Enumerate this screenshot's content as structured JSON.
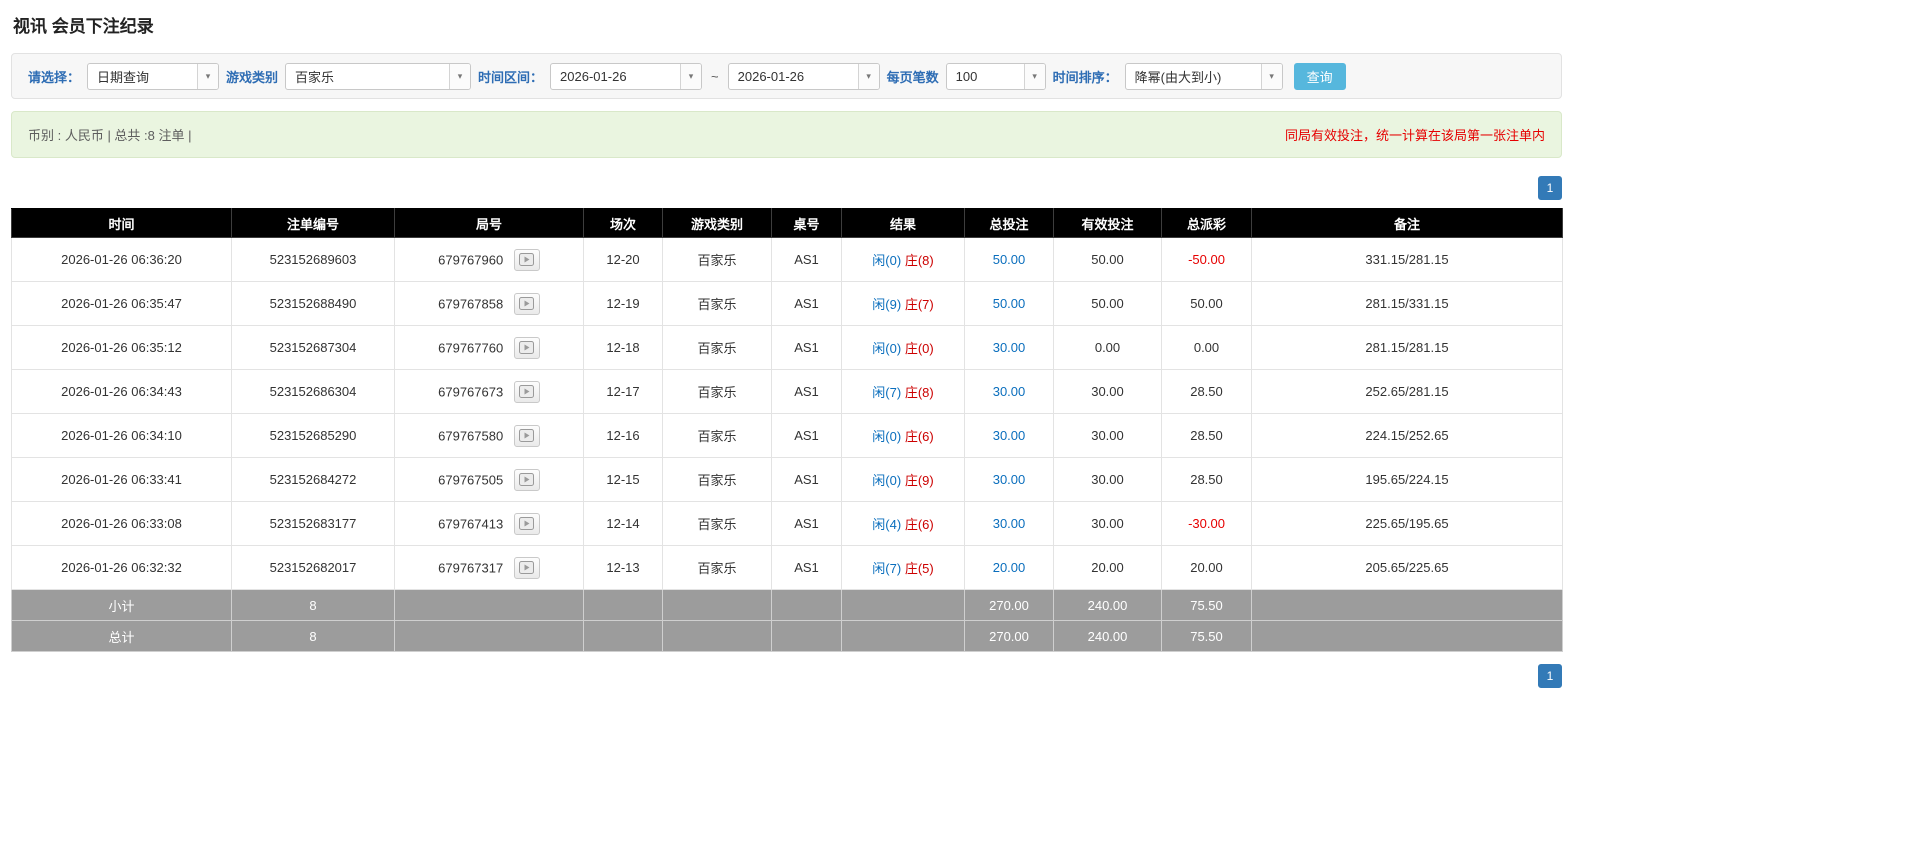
{
  "page": {
    "title": "视讯 会员下注纪录"
  },
  "filters": {
    "select_label": "请选择：",
    "select_value": "日期查询",
    "game_label": "游戏类别",
    "game_value": "百家乐",
    "range_label": "时间区间：",
    "date_from": "2026-01-26",
    "range_separator": "~",
    "date_to": "2026-01-26",
    "page_size_label": "每页笔数",
    "page_size_value": "100",
    "sort_label": "时间排序：",
    "sort_value": "降幂(由大到小)",
    "query_button_label": "查询"
  },
  "info_bar": {
    "summary": "币别 : 人民币 | 总共 :8 注单 |",
    "notice": "同局有效投注，统一计算在该局第一张注单内"
  },
  "pagination": {
    "current_page": "1"
  },
  "table": {
    "headers": [
      "时间",
      "注单编号",
      "局号",
      "场次",
      "游戏类别",
      "桌号",
      "结果",
      "总投注",
      "有效投注",
      "总派彩",
      "备注"
    ],
    "rows": [
      {
        "time": "2026-01-26 06:36:20",
        "bet_id": "523152689603",
        "round": "679767960",
        "session": "12-20",
        "game": "百家乐",
        "table_no": "AS1",
        "result_player": "闲(0)",
        "result_banker": "庄(8)",
        "total_bet": "50.00",
        "valid_bet": "50.00",
        "payout": "-50.00",
        "remark": "331.15/281.15",
        "highlight": false
      },
      {
        "time": "2026-01-26 06:35:47",
        "bet_id": "523152688490",
        "round": "679767858",
        "session": "12-19",
        "game": "百家乐",
        "table_no": "AS1",
        "result_player": "闲(9)",
        "result_banker": "庄(7)",
        "total_bet": "50.00",
        "valid_bet": "50.00",
        "payout": "50.00",
        "remark": "281.15/331.15",
        "highlight": false
      },
      {
        "time": "2026-01-26 06:35:12",
        "bet_id": "523152687304",
        "round": "679767760",
        "session": "12-18",
        "game": "百家乐",
        "table_no": "AS1",
        "result_player": "闲(0)",
        "result_banker": "庄(0)",
        "total_bet": "30.00",
        "valid_bet": "0.00",
        "payout": "0.00",
        "remark": "281.15/281.15",
        "highlight": false
      },
      {
        "time": "2026-01-26 06:34:43",
        "bet_id": "523152686304",
        "round": "679767673",
        "session": "12-17",
        "game": "百家乐",
        "table_no": "AS1",
        "result_player": "闲(7)",
        "result_banker": "庄(8)",
        "total_bet": "30.00",
        "valid_bet": "30.00",
        "payout": "28.50",
        "remark": "252.65/281.15",
        "highlight": false
      },
      {
        "time": "2026-01-26 06:34:10",
        "bet_id": "523152685290",
        "round": "679767580",
        "session": "12-16",
        "game": "百家乐",
        "table_no": "AS1",
        "result_player": "闲(0)",
        "result_banker": "庄(6)",
        "total_bet": "30.00",
        "valid_bet": "30.00",
        "payout": "28.50",
        "remark": "224.15/252.65",
        "highlight": false
      },
      {
        "time": "2026-01-26 06:33:41",
        "bet_id": "523152684272",
        "round": "679767505",
        "session": "12-15",
        "game": "百家乐",
        "table_no": "AS1",
        "result_player": "闲(0)",
        "result_banker": "庄(9)",
        "total_bet": "30.00",
        "valid_bet": "30.00",
        "payout": "28.50",
        "remark": "195.65/224.15",
        "highlight": true
      },
      {
        "time": "2026-01-26 06:33:08",
        "bet_id": "523152683177",
        "round": "679767413",
        "session": "12-14",
        "game": "百家乐",
        "table_no": "AS1",
        "result_player": "闲(4)",
        "result_banker": "庄(6)",
        "total_bet": "30.00",
        "valid_bet": "30.00",
        "payout": "-30.00",
        "remark": "225.65/195.65",
        "highlight": false
      },
      {
        "time": "2026-01-26 06:32:32",
        "bet_id": "523152682017",
        "round": "679767317",
        "session": "12-13",
        "game": "百家乐",
        "table_no": "AS1",
        "result_player": "闲(7)",
        "result_banker": "庄(5)",
        "total_bet": "20.00",
        "valid_bet": "20.00",
        "payout": "20.00",
        "remark": "205.65/225.65",
        "highlight": false
      }
    ],
    "subtotal": {
      "label": "小计",
      "count": "8",
      "total_bet": "270.00",
      "valid_bet": "240.00",
      "payout": "75.50"
    },
    "total": {
      "label": "总计",
      "count": "8",
      "total_bet": "270.00",
      "valid_bet": "240.00",
      "payout": "75.50"
    }
  },
  "colors": {
    "accent_blue": "#337ab7",
    "button_blue": "#56b7dd",
    "label_blue": "#2e6db4",
    "link_blue": "#0a6ebd",
    "player_blue": "#0a6ebd",
    "banker_red": "#cc0000",
    "negative_red": "#e60000",
    "highlight_yellow": "#fafa96",
    "header_bg": "#000000",
    "summary_bg": "#9c9c9c",
    "info_bg": "#eaf5e0"
  }
}
